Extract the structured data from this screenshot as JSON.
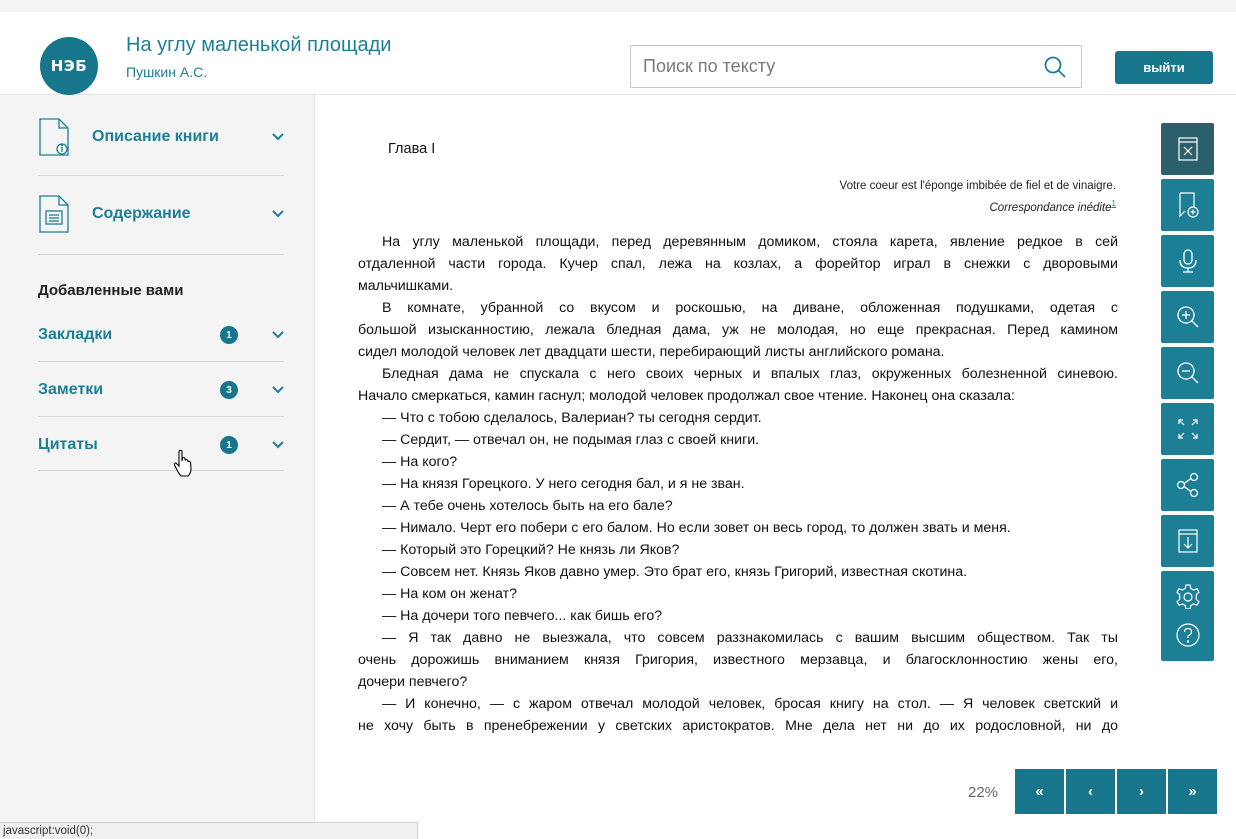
{
  "header": {
    "logo_text": "НЭБ",
    "book_title": "На углу маленькой площади",
    "author": "Пушкин А.С.",
    "search_placeholder": "Поиск по тексту",
    "logout_label": "выйти"
  },
  "sidebar": {
    "description_label": "Описание книги",
    "contents_label": "Содержание",
    "added_title": "Добавленные вами",
    "items": [
      {
        "label": "Закладки",
        "count": "1"
      },
      {
        "label": "Заметки",
        "count": "3"
      },
      {
        "label": "Цитаты",
        "count": "1"
      }
    ]
  },
  "reader": {
    "chapter": "Глава I",
    "epigraph_text": "Votre coeur est l'éponge imbibée de fiel et de vinaigre.",
    "epigraph_source": "Correspondance inédite",
    "footnote_mark": "1",
    "lines": [
      "На углу маленькой площади, перед деревянным домиком, стояла карета, явление редкое в сей",
      "отдаленной части города. Кучер спал, лежа на козлах, а форейтор играл в снежки с дворовыми",
      "мальчишками.",
      "В комнате, убранной со вкусом и роскошью, на диване, обложенная подушками, одетая с",
      "большой изысканностию, лежала бледная дама, уж не молодая, но еще прекрасная. Перед камином",
      "сидел молодой человек лет двадцати шести, перебирающий листы английского романа.",
      "Бледная дама не спускала с него своих черных и впалых глаз, окруженных болезненной синевою.",
      "Начало смеркаться, камин гаснул; молодой человек продолжал свое чтение. Наконец она сказала:",
      "— Что с тобою сделалось, Валериан? ты сегодня сердит.",
      "— Сердит, — отвечал он, не подымая глаз с своей книги.",
      "— На кого?",
      "— На князя Горецкого. У него сегодня бал, и я не зван.",
      "— А тебе очень хотелось быть на его бале?",
      "— Нимало. Черт его побери с его балом. Но если зовет он весь город, то должен звать и меня.",
      "— Который это Горецкий? Не князь ли Яков?",
      "— Совсем нет. Князь Яков давно умер. Это брат его, князь Григорий, известная скотина.",
      "— На ком он женат?",
      "— На дочери того певчего... как бишь его?",
      "— Я так давно не выезжала, что совсем раззнакомилась с вашим высшим обществом. Так ты",
      "очень дорожишь вниманием князя Григория, известного мерзавца, и благосклонностию жены его,",
      "дочери певчего?",
      "— И конечно, — с жаром отвечал молодой человек, бросая книгу на стол. — Я человек светский и",
      "не хочу быть в пренебрежении у светских аристократов. Мне дела нет ни до их родословной, ни до"
    ]
  },
  "toolbar": {
    "icons": [
      "close-book-icon",
      "add-bookmark-icon",
      "microphone-icon",
      "zoom-in-icon",
      "zoom-out-icon",
      "fullscreen-icon",
      "share-icon",
      "download-icon",
      "settings-icon",
      "help-icon"
    ]
  },
  "pagination": {
    "progress": "22%",
    "first": "«",
    "prev": "‹",
    "next": "›",
    "last": "»"
  },
  "statusbar": {
    "text": "javascript:void(0);"
  },
  "colors": {
    "accent": "#17768c",
    "link": "#1c7f95",
    "sidebar_bg": "#f4f4f4",
    "tool_active": "#2c5f6c"
  }
}
